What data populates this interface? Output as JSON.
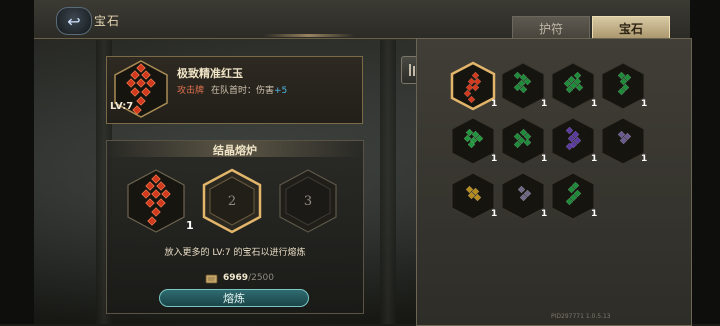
{
  "header": {
    "title": "宝石",
    "tabs": [
      "护符",
      "宝石"
    ],
    "active_tab": "宝石"
  },
  "detail": {
    "name": "极致精准红玉",
    "level": "LV:7",
    "type": "攻击牌",
    "effect_prefix": "在队首时：伤害",
    "effect_value": "+5"
  },
  "furnace": {
    "title": "结晶熔炉",
    "slots": [
      {
        "label": "1",
        "filled": true,
        "count": "1"
      },
      {
        "label": "2",
        "filled": false,
        "selected": true
      },
      {
        "label": "3",
        "filled": false
      }
    ],
    "hint": "放入更多的 LV:7 的宝石以进行熔炼",
    "cost_current": "6969",
    "cost_max": "/2500",
    "smelt_label": "熔炼"
  },
  "inventory": {
    "items": [
      {
        "color": "#d23a1e",
        "count": "1",
        "selected": true
      },
      {
        "color": "#1f8a3a",
        "count": "1"
      },
      {
        "color": "#1f8a3a",
        "count": "1"
      },
      {
        "color": "#1f8a3a",
        "count": "1"
      },
      {
        "color": "#22953e",
        "count": "1"
      },
      {
        "color": "#1f8a3a",
        "count": "1"
      },
      {
        "color": "#5b3aa0",
        "count": "1"
      },
      {
        "color": "#6a5a8e",
        "count": "1"
      },
      {
        "color": "#b58a1e",
        "count": "1"
      },
      {
        "color": "#6e6a86",
        "count": "1"
      },
      {
        "color": "#1f8a3a",
        "count": "1"
      }
    ]
  },
  "footer": {
    "id": "PID297771  1.0.5.13"
  },
  "colors": {
    "gold": "#d9b56a",
    "teal": "#79c6c4",
    "red_gem": "#d23a1e"
  }
}
